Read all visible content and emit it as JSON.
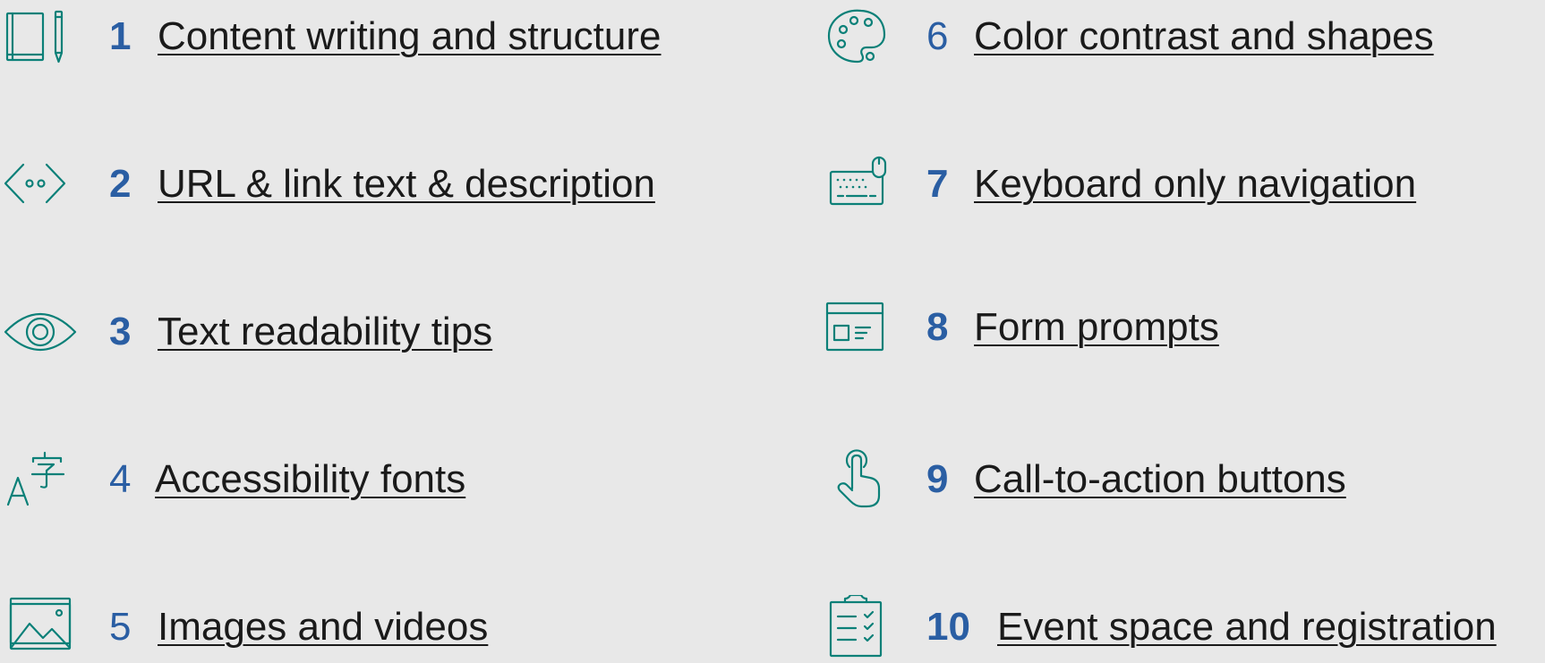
{
  "colors": {
    "background": "#e8e8e8",
    "number": "#2a5ea3",
    "link_text": "#1a1a1a",
    "icon": "#0b8078"
  },
  "topics": [
    {
      "number": "1",
      "label": "Content writing and structure",
      "icon": "book-pencil-icon"
    },
    {
      "number": "2",
      "label": "URL & link text & description",
      "icon": "code-brackets-icon"
    },
    {
      "number": "3",
      "label": "Text readability tips",
      "icon": "eye-icon"
    },
    {
      "number": "4",
      "label": "Accessibility fonts",
      "icon": "language-font-icon"
    },
    {
      "number": "5",
      "label": "Images and videos",
      "icon": "image-gallery-icon"
    },
    {
      "number": "6",
      "label": "Color contrast and shapes",
      "icon": "palette-icon"
    },
    {
      "number": "7",
      "label": "Keyboard only navigation",
      "icon": "keyboard-mouse-icon"
    },
    {
      "number": "8",
      "label": "Form prompts",
      "icon": "form-icon"
    },
    {
      "number": "9",
      "label": "Call-to-action buttons",
      "icon": "tap-finger-icon"
    },
    {
      "number": "10",
      "label": "Event space and registration",
      "icon": "clipboard-checklist-icon"
    }
  ]
}
